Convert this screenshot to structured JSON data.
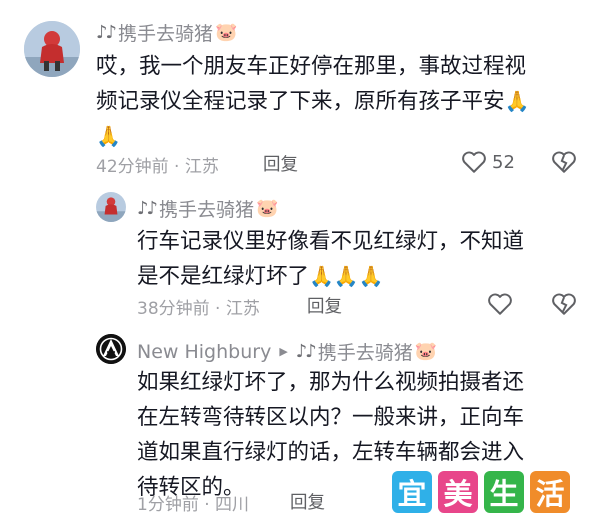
{
  "comments": [
    {
      "user_note": "♪♪",
      "user_name": "携手去骑猪",
      "user_emoji": "🐷",
      "text_line1": "哎，我一个朋友车正好停在那里，事故过程视",
      "text_line2": "频记录仪全程记录了下来，原所有孩子平安",
      "emoji": "🙏",
      "time_location": "42分钟前 · 江苏",
      "reply_label": "回复",
      "like_count": "52"
    },
    {
      "user_note": "♪♪",
      "user_name": "携手去骑猪",
      "user_emoji": "🐷",
      "text_line1": "行车记录仪里好像看不见红绿灯，不知道",
      "text_line2": "是不是红绿灯坏了",
      "emoji": "🙏",
      "time_location": "38分钟前 · 江苏",
      "reply_label": "回复"
    },
    {
      "user_name": "New Highbury",
      "arrow": "▶",
      "reply_to_note": "♪♪",
      "reply_to_name": "携手去骑猪",
      "reply_to_emoji": "🐷",
      "text_line1": "如果红绿灯坏了，那为什么视频拍摄者还",
      "text_line2": "在左转弯待转区以内？一般来讲，正向车",
      "text_line3": "道如果直行绿灯的话，左转车辆都会进入",
      "text_line4": "待转区的。",
      "time_location": "1分钟前 · 四川",
      "reply_label": "回复"
    }
  ],
  "watermark": [
    "宜",
    "美",
    "生",
    "活"
  ],
  "colors": {
    "text": "#161823",
    "meta": "#9fa0a5",
    "watermark": [
      "#2fb0e8",
      "#e8468a",
      "#35b54a",
      "#f08c2a"
    ]
  },
  "icons": [
    "heart-outline-icon",
    "broken-heart-icon",
    "linkin-park-logo-icon"
  ]
}
